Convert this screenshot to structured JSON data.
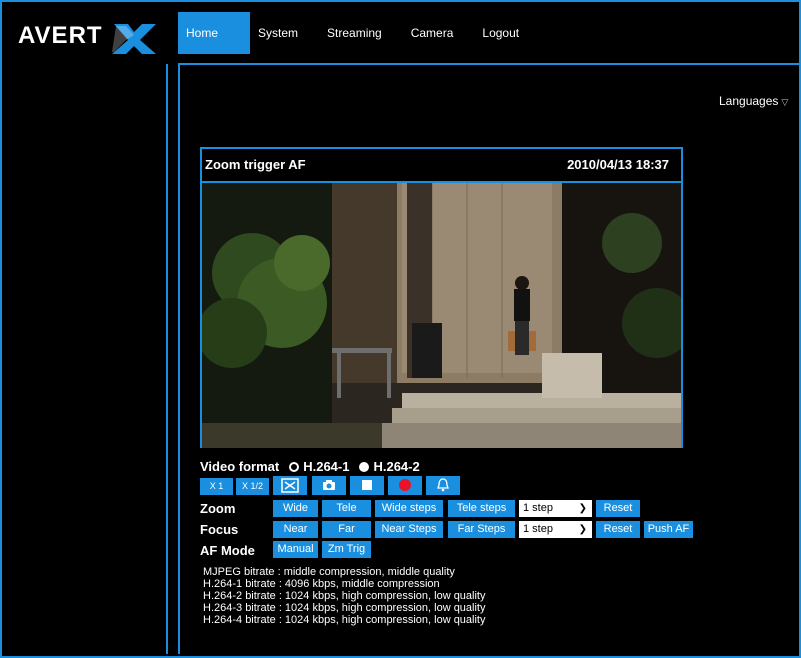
{
  "brand": {
    "logo_text": "AVERT X"
  },
  "nav": {
    "items": [
      {
        "label": "Home"
      },
      {
        "label": "System"
      },
      {
        "label": "Streaming"
      },
      {
        "label": "Camera"
      },
      {
        "label": "Logout"
      }
    ],
    "active": "Home"
  },
  "languages": {
    "label": "Languages",
    "icon": "triangle-down-icon"
  },
  "video": {
    "title": "Zoom trigger AF",
    "timestamp": "2010/04/13 18:37"
  },
  "video_format": {
    "label": "Video format",
    "options": [
      {
        "label": "H.264-1",
        "selected": false
      },
      {
        "label": "H.264-2",
        "selected": true
      }
    ]
  },
  "toolbar": {
    "x1_label": "X 1",
    "x12_label": "X 1/2",
    "icons": [
      "fullscreen-icon",
      "snapshot-camera-icon",
      "stop-icon",
      "record-icon",
      "alarm-bell-icon"
    ]
  },
  "zoom": {
    "label": "Zoom",
    "wide": "Wide",
    "tele": "Tele",
    "wide_steps": "Wide steps",
    "tele_steps": "Tele steps",
    "step_select": "1 step",
    "reset": "Reset"
  },
  "focus": {
    "label": "Focus",
    "near": "Near",
    "far": "Far",
    "near_steps": "Near Steps",
    "far_steps": "Far Steps",
    "step_select": "1 step",
    "reset": "Reset",
    "push_af": "Push AF"
  },
  "af_mode": {
    "label": "AF Mode",
    "manual": "Manual",
    "zm_trig": "Zm Trig"
  },
  "bitrate_lines": [
    "MJPEG bitrate : middle compression, middle quality",
    "H.264-1 bitrate : 4096 kbps, middle compression",
    "H.264-2 bitrate : 1024 kbps, high compression, low quality",
    "H.264-3 bitrate : 1024 kbps, high compression, low quality",
    "H.264-4 bitrate : 1024 kbps, high compression, low quality"
  ],
  "colors": {
    "accent": "#1a8fe0",
    "background": "#000000"
  }
}
